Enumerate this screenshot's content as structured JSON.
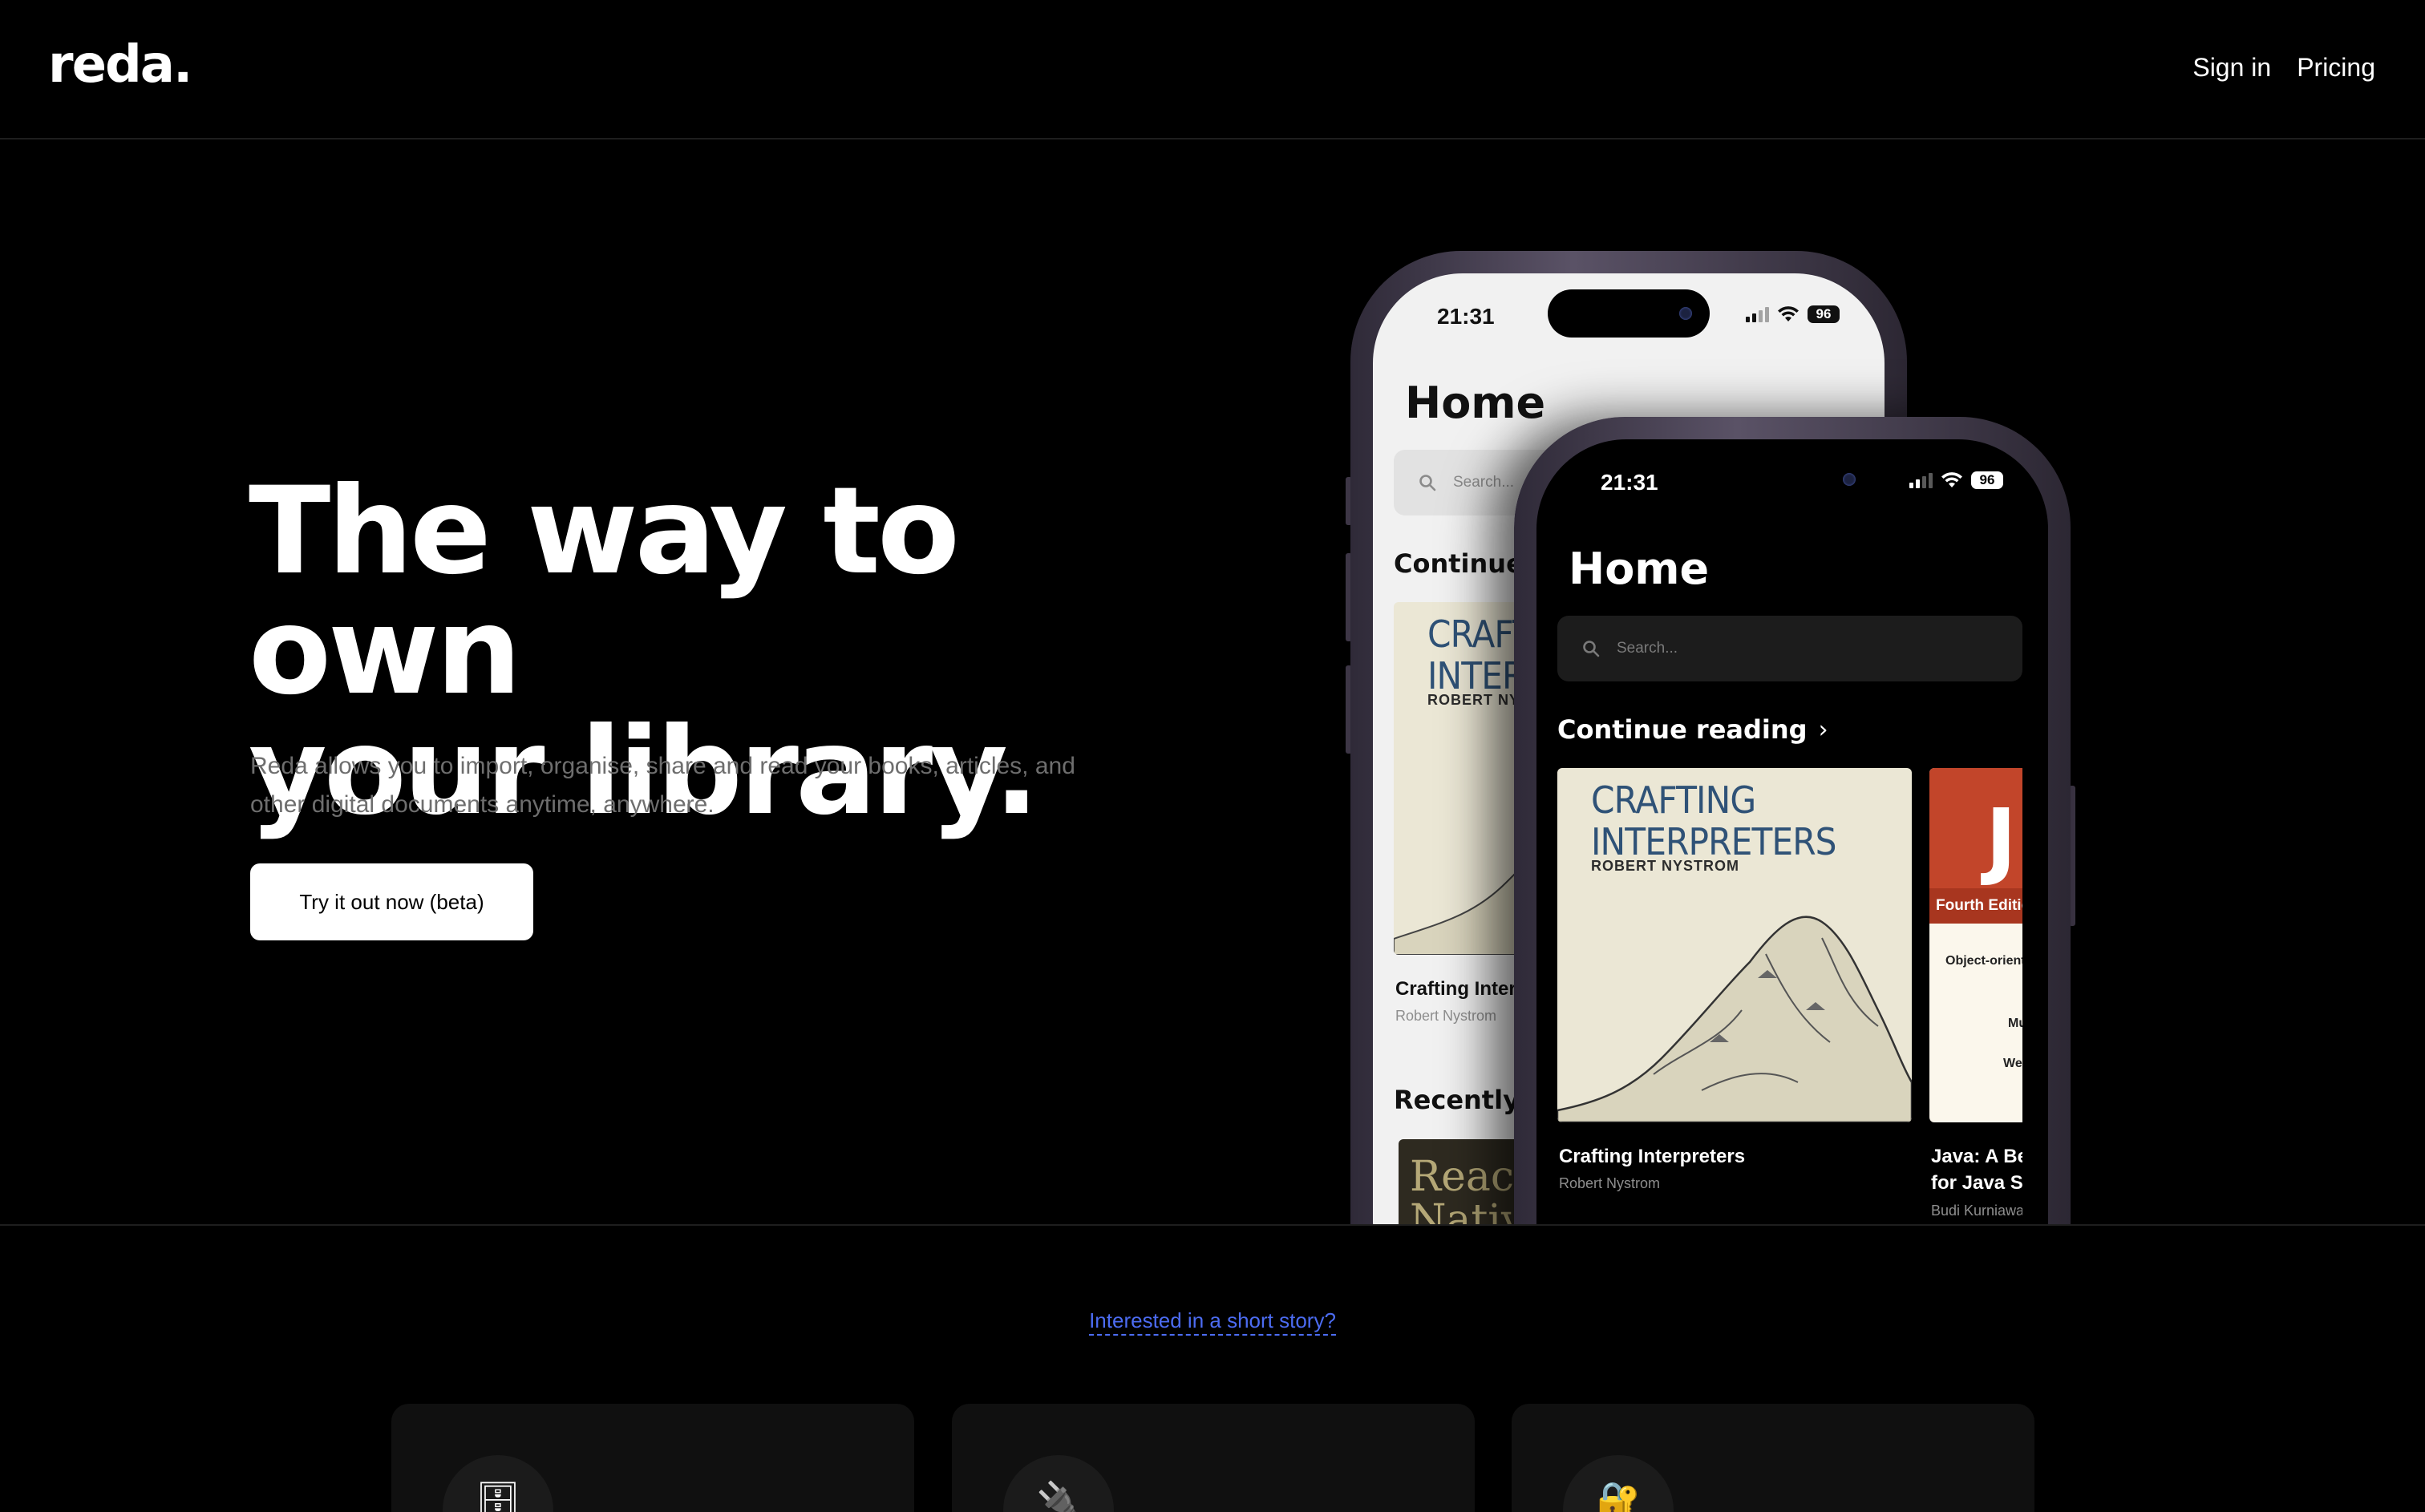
{
  "header": {
    "logo": "reda.",
    "nav": [
      {
        "label": "Sign in"
      },
      {
        "label": "Pricing"
      }
    ]
  },
  "hero": {
    "title_line1": "The way to own",
    "title_line2": "your library.",
    "subtitle_line1": "Reda allows you to import, organise, share and read your books, articles, and",
    "subtitle_line2": "other digital documents anytime, anywhere.",
    "cta_label": "Try it out now (beta)"
  },
  "phone_light": {
    "time": "21:31",
    "battery": "96",
    "home_title": "Home",
    "search_placeholder": "Search...",
    "continue_label": "Continue reading",
    "cover_title_line1": "CRAFTING",
    "cover_title_line2": "INTERPRETERS",
    "cover_author": "ROBERT NYSTROM",
    "book_title": "Crafting Interpreters",
    "book_author": "Robert Nystrom",
    "recently_label": "Recently added",
    "recent_cover_line1": "React",
    "recent_cover_line2": "Native"
  },
  "phone_dark": {
    "time": "21:31",
    "battery": "96",
    "home_title": "Home",
    "search_placeholder": "Search...",
    "continue_label": "Continue reading",
    "books": [
      {
        "cover_title_line1": "CRAFTING",
        "cover_title_line2": "INTERPRETERS",
        "cover_author": "ROBERT NYSTROM",
        "title": "Crafting Interpreters",
        "author": "Robert Nystrom"
      },
      {
        "cover_letter": "J",
        "cover_edition": "Fourth Edition",
        "cover_line1": "Object-oriented",
        "cover_line2": "Mu",
        "cover_line3": "We",
        "title_line1": "Java: A Beginner's Guide",
        "title_line2": "for Java SE",
        "author": "Budi Kurniawan"
      }
    ]
  },
  "story": {
    "link_label": "Interested in a short story?"
  },
  "feature_cards": [
    {
      "icon": "file-cabinet-icon",
      "glyph": "🗄"
    },
    {
      "icon": "plug-icon",
      "glyph": "🔌"
    },
    {
      "icon": "lock-key-icon",
      "glyph": "🔐"
    }
  ]
}
